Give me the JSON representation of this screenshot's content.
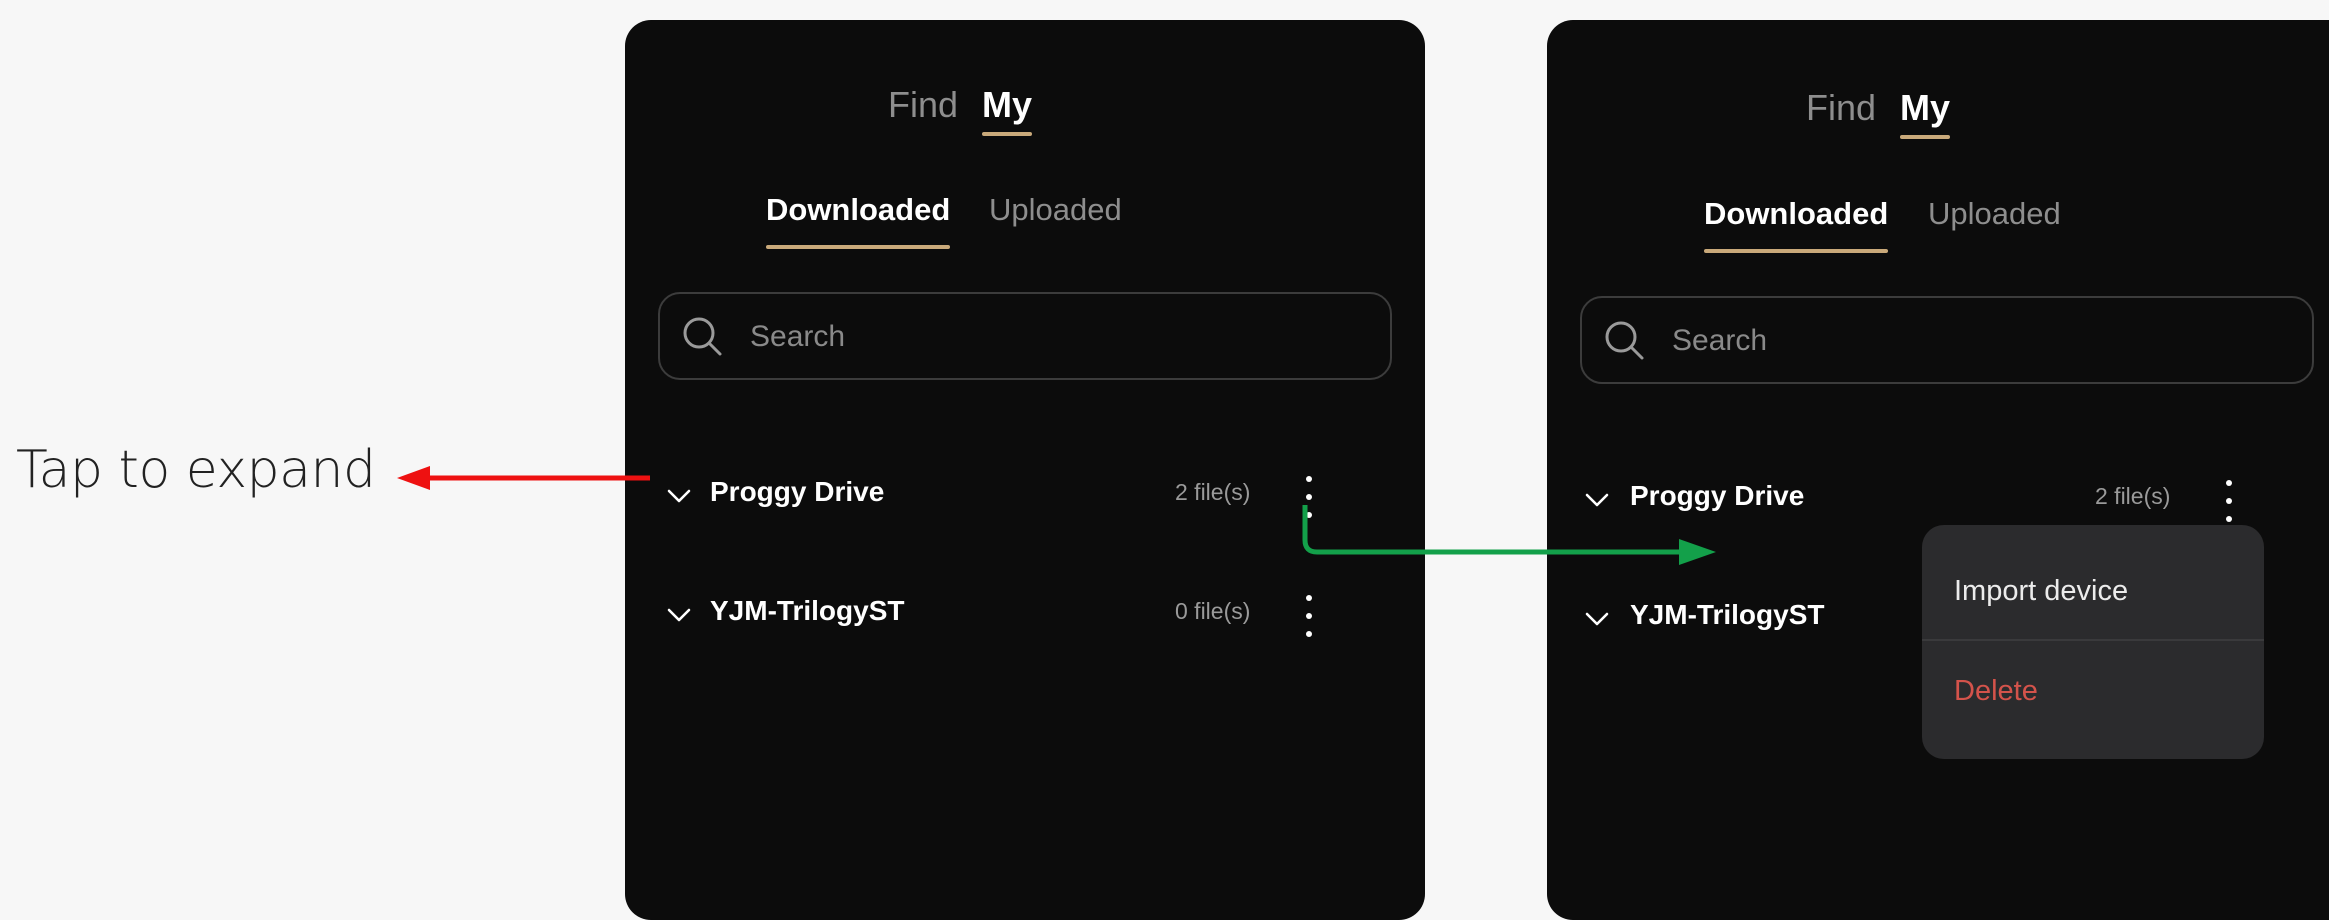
{
  "annotation": {
    "tap_label": "Tap to expand",
    "arrow_colors": {
      "tap": "#ee1111",
      "menu": "#13a04a"
    }
  },
  "screens": [
    {
      "tabs": {
        "find": "Find",
        "my": "My",
        "active": "My"
      },
      "subtabs": {
        "downloaded": "Downloaded",
        "uploaded": "Uploaded",
        "active": "Downloaded"
      },
      "search": {
        "placeholder": "Search"
      },
      "devices": [
        {
          "name": "Proggy Drive",
          "count": "2 file(s)"
        },
        {
          "name": "YJM-TrilogyST",
          "count": "0 file(s)"
        }
      ]
    },
    {
      "tabs": {
        "find": "Find",
        "my": "My",
        "active": "My"
      },
      "subtabs": {
        "downloaded": "Downloaded",
        "uploaded": "Uploaded",
        "active": "Downloaded"
      },
      "search": {
        "placeholder": "Search"
      },
      "devices": [
        {
          "name": "Proggy Drive",
          "count": "2 file(s)"
        },
        {
          "name": "YJM-TrilogyST"
        }
      ],
      "context_menu": {
        "import_label": "Import device",
        "delete_label": "Delete"
      }
    }
  ],
  "colors": {
    "background": "#f7f7f7",
    "phone_background": "#0c0c0c",
    "accent_underline": "#c9a97a",
    "delete_text": "#d4534b"
  }
}
